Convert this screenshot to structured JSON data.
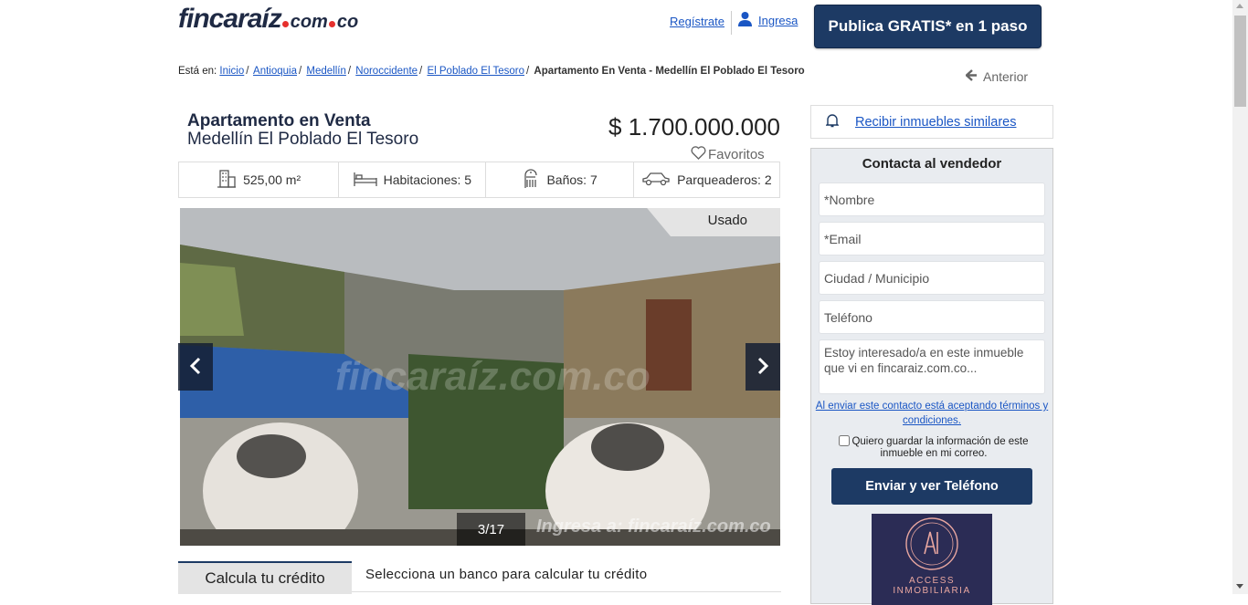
{
  "header": {
    "logo_main": "fincaraíz",
    "logo_sub": "com",
    "logo_tld": "co",
    "register_label": "Regístrate",
    "login_label": "Ingresa",
    "publish_label": "Publica GRATIS* en 1 paso"
  },
  "breadcrumb": {
    "prefix": "Está en:",
    "items": [
      "Inicio",
      "Antioquia",
      "Medellín",
      "Noroccidente",
      "El Poblado El Tesoro"
    ],
    "current": "Apartamento En Venta - Medellín El Poblado El Tesoro",
    "previous_label": "Anterior"
  },
  "property": {
    "title": "Apartamento en Venta",
    "location": "Medellín El Poblado El Tesoro",
    "price": "$ 1.700.000.000",
    "favorites_label": "Favoritos",
    "features": {
      "area": "525,00 m²",
      "rooms": "Habitaciones: 5",
      "baths": "Baños: 7",
      "parking": "Parqueaderos: 2"
    },
    "condition": "Usado"
  },
  "gallery": {
    "counter": "3/17",
    "watermark": "fincaraíz.com.co",
    "watermark_footer": "Ingresa a: fincaraíz.com.co"
  },
  "credit": {
    "tab_label": "Calcula tu crédito",
    "prompt": "Selecciona un banco para calcular tu crédito"
  },
  "sidebar": {
    "similar_label": "Recibir inmuebles similares",
    "contact_title": "Contacta al vendedor",
    "name_placeholder": "*Nombre",
    "email_placeholder": "*Email",
    "city_placeholder": "Ciudad / Municipio",
    "phone_placeholder": "Teléfono",
    "message_placeholder": "Estoy interesado/a en este inmueble que vi en fincaraiz.com.co...",
    "terms_text": "Al enviar este contacto está aceptando términos y condiciones.",
    "save_text": "Quiero guardar la información de este inmueble en mi correo.",
    "send_label": "Enviar y ver Teléfono",
    "agency_name": "ACCESS INMOBILIARIA",
    "agency_initials": "AI"
  },
  "colors": {
    "brand_dark": "#1d3a64",
    "logo_dot": "#e5302d",
    "link": "#1a56c4"
  }
}
